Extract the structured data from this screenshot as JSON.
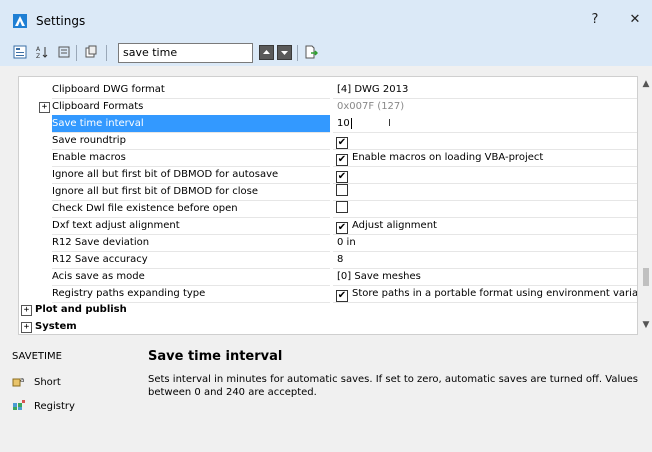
{
  "window": {
    "title": "Settings",
    "help_label": "?",
    "close_label": "✕"
  },
  "toolbar": {
    "search_value": "save time"
  },
  "rows": [
    {
      "label": "Clipboard DWG format",
      "value": "[4] DWG 2013"
    },
    {
      "label": "Clipboard Formats",
      "value": "0x007F (127)"
    },
    {
      "label": "Save time interval",
      "value": "10"
    },
    {
      "label": "Save roundtrip",
      "value": ""
    },
    {
      "label": "Enable macros",
      "value": "Enable macros on loading VBA-project"
    },
    {
      "label": "Ignore all but first bit of DBMOD for autosave",
      "value": ""
    },
    {
      "label": "Ignore all but first bit of DBMOD for close",
      "value": ""
    },
    {
      "label": "Check Dwl file existence before open",
      "value": ""
    },
    {
      "label": "Dxf text adjust alignment",
      "value": "Adjust alignment"
    },
    {
      "label": "R12 Save deviation",
      "value": "0 in"
    },
    {
      "label": "R12 Save accuracy",
      "value": "8"
    },
    {
      "label": "Acis save as mode",
      "value": "[0] Save meshes"
    },
    {
      "label": "Registry paths expanding type",
      "value": "Store paths in a portable format using environment variables."
    }
  ],
  "checkboxes": {
    "save_roundtrip": true,
    "enable_macros": true,
    "ignore_autosave": true,
    "ignore_close": false,
    "check_dwl": false,
    "dxf_adjust": true,
    "registry_paths": true
  },
  "categories": [
    {
      "label": "Plot and publish"
    },
    {
      "label": "System"
    }
  ],
  "help": {
    "command": "SAVETIME",
    "title": "Save time interval",
    "description": "Sets interval in minutes for automatic saves. If set to zero, automatic saves are turned off. Values between 0 and 240 are accepted.",
    "short_label": "Short",
    "registry_label": "Registry"
  },
  "colors": {
    "titlebar": "#dbe9f7",
    "selection": "#3399ff"
  }
}
